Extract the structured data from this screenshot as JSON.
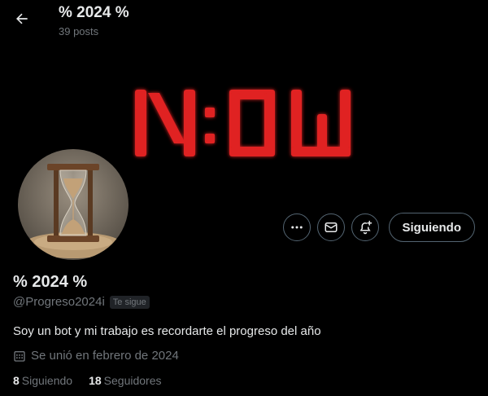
{
  "header": {
    "title": "% 2024 %",
    "posts": "39 posts",
    "back_icon": "arrow-left-icon"
  },
  "banner": {
    "text": "N:OW",
    "color": "#e02020"
  },
  "profile": {
    "name": "% 2024 %",
    "handle": "@Progreso2024i",
    "follows_you": "Te sigue",
    "bio": "Soy un bot y mi trabajo es recordarte el progreso del año",
    "joined": "Se unió en febrero de 2024",
    "following_count": "8",
    "following_label": "Siguiendo",
    "followers_count": "18",
    "followers_label": "Seguidores"
  },
  "actions": {
    "more_icon": "more-icon",
    "message_icon": "mail-icon",
    "notify_icon": "bell-plus-icon",
    "follow_label": "Siguiendo"
  },
  "colors": {
    "background": "#000000",
    "text": "#e7e9ea",
    "muted": "#71767b",
    "border": "#536471"
  }
}
